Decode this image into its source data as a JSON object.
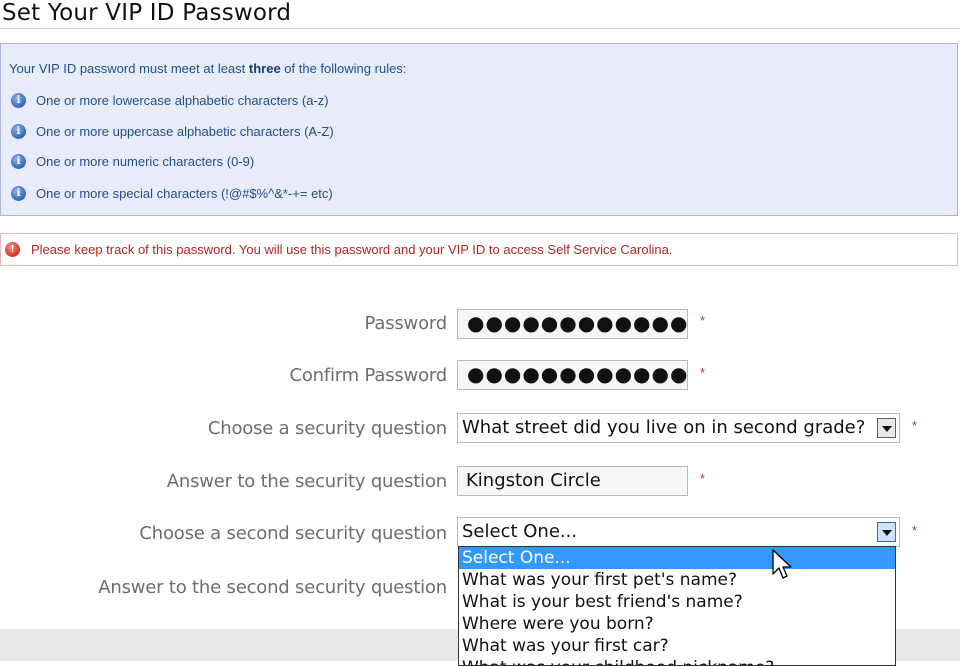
{
  "page": {
    "title": "Set Your VIP ID Password"
  },
  "rules_box": {
    "intro_pre": "Your VIP ID password must meet at least ",
    "intro_bold": "three",
    "intro_post": " of the following rules:",
    "rules": [
      "One or more lowercase alphabetic characters (a-z)",
      "One or more uppercase alphabetic characters (A-Z)",
      "One or more numeric characters (0-9)",
      "One or more special characters (!@#$%^&*-+= etc)"
    ],
    "icon": "info-icon"
  },
  "warning": {
    "text": "Please keep track of this password. You will use this password and your VIP ID to access Self Service Carolina.",
    "icon": "alert-icon"
  },
  "form": {
    "password_label": "Password",
    "password_value": "●●●●●●●●●●●●",
    "confirm_label": "Confirm Password",
    "confirm_value": "●●●●●●●●●●●●",
    "q1_label": "Choose a security question",
    "q1_value": "What street did you live on in second grade?",
    "a1_label": "Answer to the security question",
    "a1_value": "Kingston Circle",
    "q2_label": "Choose a second security question",
    "q2_value": "Select One...",
    "a2_label": "Answer to the second security question",
    "required_mark": "*"
  },
  "dropdown": {
    "options": [
      "Select One...",
      "What was your first pet's name?",
      "What is your best friend's name?",
      "Where were you born?",
      "What was your first car?",
      "What was your childhood nickname?"
    ],
    "selected_index": 0
  },
  "colors": {
    "info_bg": "#e8ecfa",
    "highlight": "#3399ff",
    "required": "#c0392b"
  }
}
